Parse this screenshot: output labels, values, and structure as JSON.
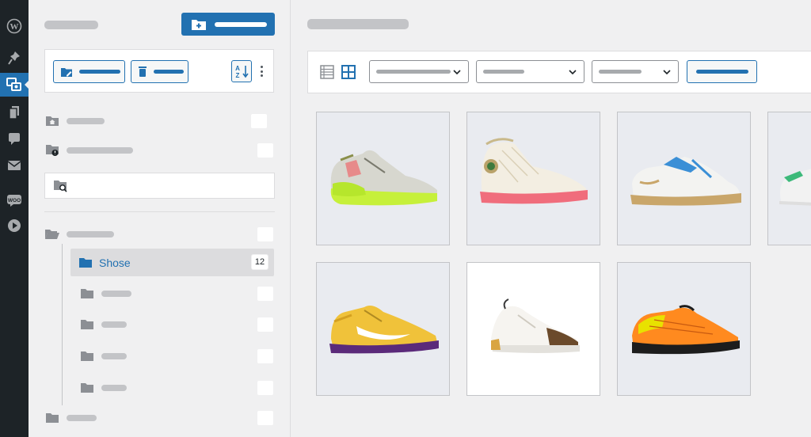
{
  "admin_menu": {
    "items": [
      {
        "icon": "wordpress-icon"
      },
      {
        "icon": "pin-icon"
      },
      {
        "icon": "media-folder-icon",
        "active": true
      },
      {
        "icon": "pages-icon"
      },
      {
        "icon": "comments-icon"
      },
      {
        "icon": "mail-icon"
      },
      {
        "icon": "woo-icon",
        "label": "WOO"
      },
      {
        "icon": "play-icon"
      }
    ]
  },
  "folders": {
    "selected": {
      "name": "Shose",
      "count": "12"
    },
    "search_placeholder": ""
  },
  "colors": {
    "accent": "#2271b1",
    "rail": "#1d2327",
    "panel": "#f0f0f1"
  },
  "products": [
    {
      "name": "neon-yellow-sneaker",
      "colors": [
        "#d2d4a8",
        "#c8f23e",
        "#e58b8b"
      ]
    },
    {
      "name": "cream-pink-highcut-sneaker",
      "colors": [
        "#f4efe4",
        "#f06d7c",
        "#b9a26a"
      ]
    },
    {
      "name": "white-blue-gum-sneaker",
      "colors": [
        "#f4f4f2",
        "#3b8fd6",
        "#c9a66a"
      ]
    },
    {
      "name": "white-green-sneaker",
      "colors": [
        "#f2f2f2",
        "#3cb97a"
      ]
    },
    {
      "name": "yellow-purple-sneaker",
      "colors": [
        "#f0c23a",
        "#5b2a7a",
        "#ffffff"
      ]
    },
    {
      "name": "white-brown-monogram-sneaker",
      "colors": [
        "#ffffff",
        "#6b4a2b",
        "#d9a542"
      ]
    },
    {
      "name": "orange-black-sneaker",
      "colors": [
        "#ff8a1f",
        "#1d1d1d",
        "#e8e200"
      ]
    }
  ]
}
